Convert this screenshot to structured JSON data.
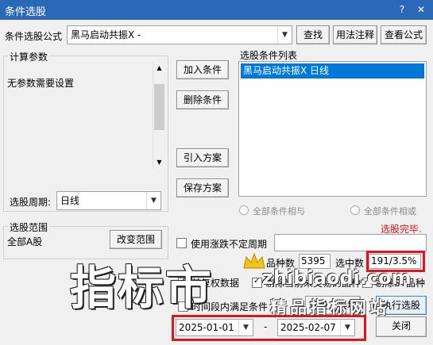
{
  "window": {
    "title": "条件选股",
    "help_icon": "?",
    "close_icon": "✕"
  },
  "formula": {
    "label": "条件选股公式",
    "value": "黑马启动共振X  -",
    "find_button": "查找",
    "usage_button": "用法注释",
    "view_button": "查看公式"
  },
  "params": {
    "group_label": "计算参数",
    "no_params_text": "无参数需要设置",
    "period_label": "选股周期:",
    "period_value": "日线"
  },
  "actions": {
    "add": "加入条件",
    "delete": "删除条件",
    "import": "引入方案",
    "save": "保存方案"
  },
  "conditions": {
    "list_label": "选股条件列表",
    "items": [
      "黑马启动共振X  日线"
    ]
  },
  "logic": {
    "and_label": "全部条件相与",
    "or_label": "全部条件相或"
  },
  "status": {
    "done_text": "选股完毕.",
    "done_color": "#e0141c"
  },
  "scope": {
    "group_label": "选股范围",
    "value": "全部A股",
    "change_button": "改变范围"
  },
  "options": {
    "unfixed_period_label": "使用涨跌不定周期",
    "count_label": "品种数",
    "count_value": "5395",
    "selected_label": "选中数",
    "selected_value": "191/3.5%",
    "pre_restore_label": "前复权数据",
    "exclude_suspended_label": "剔除当前未交易的品种",
    "exclude_st_label": "剔除ST品种",
    "time_range_label": "时间段内满足条件"
  },
  "bottom": {
    "select_to_block": "选股入板块",
    "run": "执行选股",
    "close": "关闭",
    "date_from": "2025-01-01",
    "date_sep": "-",
    "date_to": "2025-02-07"
  },
  "watermark": {
    "big_text": "指标市",
    "domain_text": "zhibiaodi.com",
    "tagline": "精品指标网站"
  }
}
